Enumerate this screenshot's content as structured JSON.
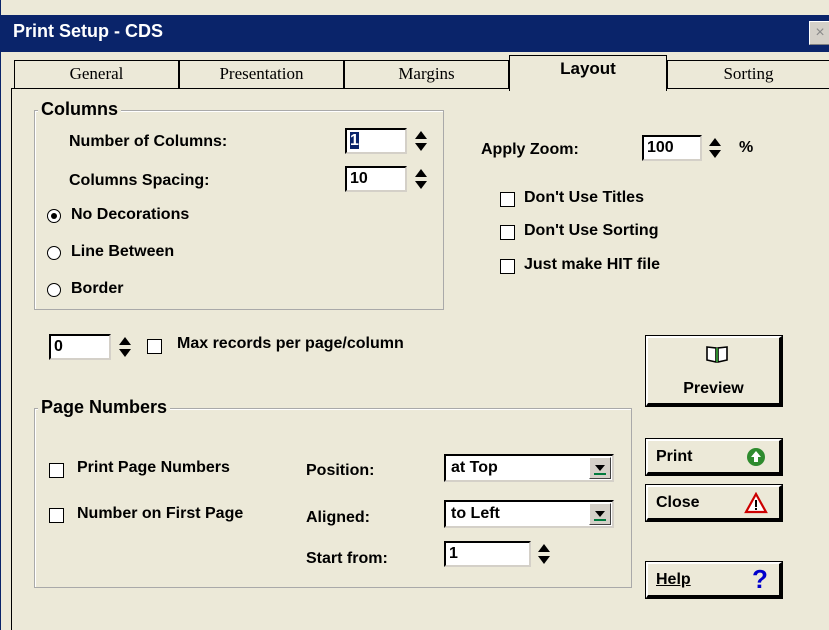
{
  "window": {
    "title": "Print Setup - CDS",
    "close_glyph": "×"
  },
  "tabs": [
    {
      "label": "General",
      "active": false
    },
    {
      "label": "Presentation",
      "active": false
    },
    {
      "label": "Margins",
      "active": false
    },
    {
      "label": "Layout",
      "active": true
    },
    {
      "label": "Sorting",
      "active": false
    }
  ],
  "columns_group": {
    "title": "Columns",
    "number_of_columns_label": "Number of Columns:",
    "number_of_columns_value": "1",
    "columns_spacing_label": "Columns Spacing:",
    "columns_spacing_value": "10",
    "decoration_options": [
      {
        "label": "No Decorations",
        "selected": true
      },
      {
        "label": "Line Between",
        "selected": false
      },
      {
        "label": "Border",
        "selected": false
      }
    ]
  },
  "zoom": {
    "label": "Apply Zoom:",
    "value": "100",
    "unit": "%"
  },
  "options": [
    {
      "label": "Don't Use Titles",
      "checked": false
    },
    {
      "label": "Don't Use Sorting",
      "checked": false
    },
    {
      "label": "Just make HIT file",
      "checked": false
    }
  ],
  "max_records": {
    "value": "0",
    "label": "Max records per page/column",
    "checked": false
  },
  "page_numbers_group": {
    "title": "Page Numbers",
    "print_page_numbers": {
      "label": "Print Page Numbers",
      "checked": false
    },
    "number_on_first_page": {
      "label": "Number on First Page",
      "checked": false
    },
    "position_label": "Position:",
    "position_value": "at Top",
    "aligned_label": "Aligned:",
    "aligned_value": "to Left",
    "start_from_label": "Start from:",
    "start_from_value": "1"
  },
  "buttons": {
    "preview": {
      "label": "Preview",
      "icon": "open-book-icon"
    },
    "print": {
      "label": "Print",
      "icon": "green-up-arrow-icon",
      "icon_color": "#2e8b2e"
    },
    "close": {
      "label": "Close",
      "icon": "warning-triangle-icon",
      "icon_color": "#cc0000"
    },
    "help": {
      "label": "Help",
      "icon": "question-mark-icon",
      "icon_color": "#0000cc"
    }
  }
}
